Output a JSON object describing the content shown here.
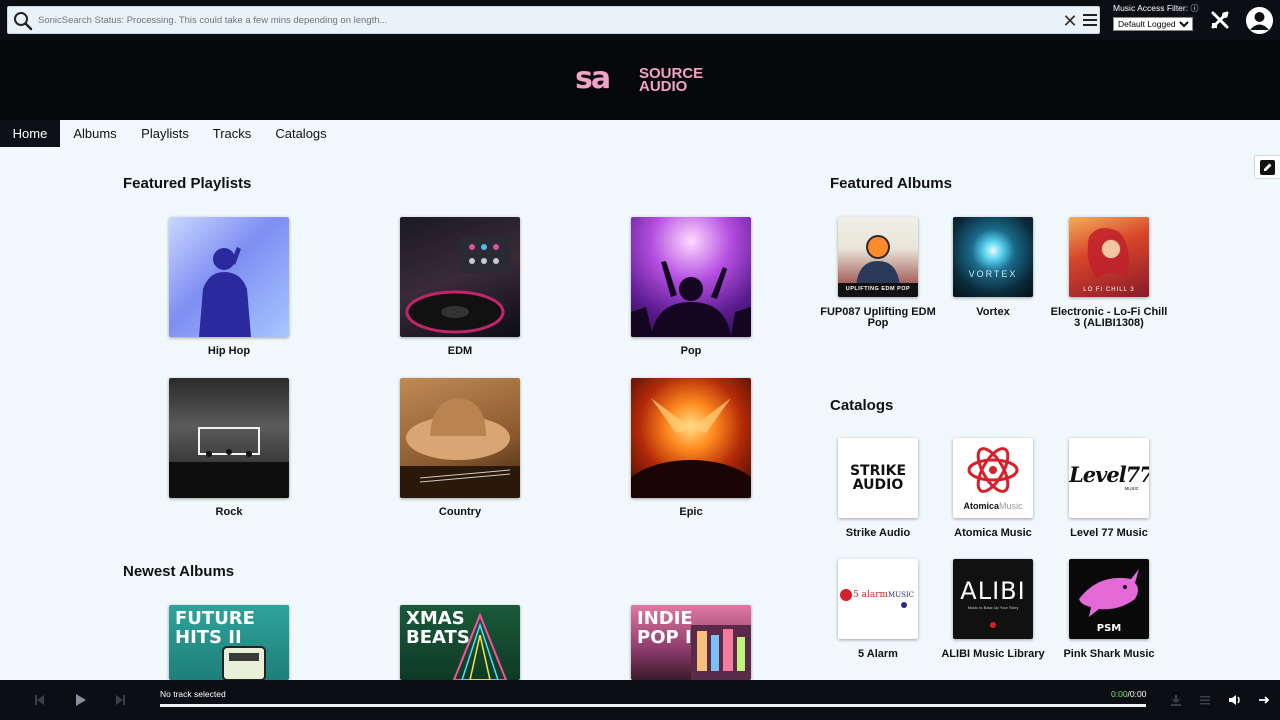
{
  "search": {
    "placeholder": "SonicSearch Status: Processing. This could take a few mins depending on length...",
    "clear_label": "✕"
  },
  "filter": {
    "label": "Music Access Filter:",
    "help": "ⓘ",
    "selected": "Default Logged I"
  },
  "brand": {
    "mark": "sa",
    "line1": "SOURCE",
    "line2": "AUDIO"
  },
  "nav": {
    "tabs": [
      "Home",
      "Albums",
      "Playlists",
      "Tracks",
      "Catalogs"
    ],
    "active": "Home"
  },
  "featured_playlists": {
    "title": "Featured Playlists",
    "items": [
      "Hip Hop",
      "EDM",
      "Pop",
      "Rock",
      "Country",
      "Epic"
    ]
  },
  "newest_albums": {
    "title": "Newest Albums",
    "items": [
      {
        "art_line1": "FUTURE",
        "art_line2": "HITS II"
      },
      {
        "art_line1": "XMAS",
        "art_line2": "BEATS"
      },
      {
        "art_line1": "INDIE",
        "art_line2": "POP II"
      }
    ]
  },
  "featured_albums": {
    "title": "Featured Albums",
    "items": [
      {
        "caption": "FUP087 Uplifting EDM Pop",
        "art_text": "UPLIFTING EDM POP"
      },
      {
        "caption": "Vortex",
        "art_text": "VORTEX"
      },
      {
        "caption": "Electronic - Lo-Fi Chill 3 (ALIBI1308)",
        "art_text": "LO FI CHILL 3"
      }
    ]
  },
  "catalogs": {
    "title": "Catalogs",
    "items": [
      {
        "caption": "Strike Audio",
        "logo_line1": "STRIKE",
        "logo_line2": "AUDIO"
      },
      {
        "caption": "Atomica Music",
        "logo_line1": "Atomica",
        "logo_line2": "Music"
      },
      {
        "caption": "Level 77 Music",
        "logo_line1": "Level77",
        "logo_line2": "MUSIC"
      },
      {
        "caption": "5 Alarm",
        "logo_line1": "5 alarm",
        "logo_line2": "MUSIC"
      },
      {
        "caption": "ALIBI Music Library",
        "logo_line1": "ALIBI",
        "logo_line2": "Music to Back Up Your Story"
      },
      {
        "caption": "Pink Shark Music",
        "logo_line1": "PSM",
        "logo_line2": ""
      }
    ]
  },
  "player": {
    "track": "No track selected",
    "current": "0:00",
    "total": "/0:00"
  },
  "icons": [
    "search-icon",
    "clear-icon",
    "menu-icon",
    "tools-icon",
    "user-icon",
    "edit-icon",
    "previous-icon",
    "play-icon",
    "next-icon",
    "download-icon",
    "queue-icon",
    "volume-icon",
    "expand-icon"
  ],
  "colors": {
    "brand_pink": "#f4a3c4",
    "dark": "#0b0f14",
    "page": "#f1f8fc"
  }
}
